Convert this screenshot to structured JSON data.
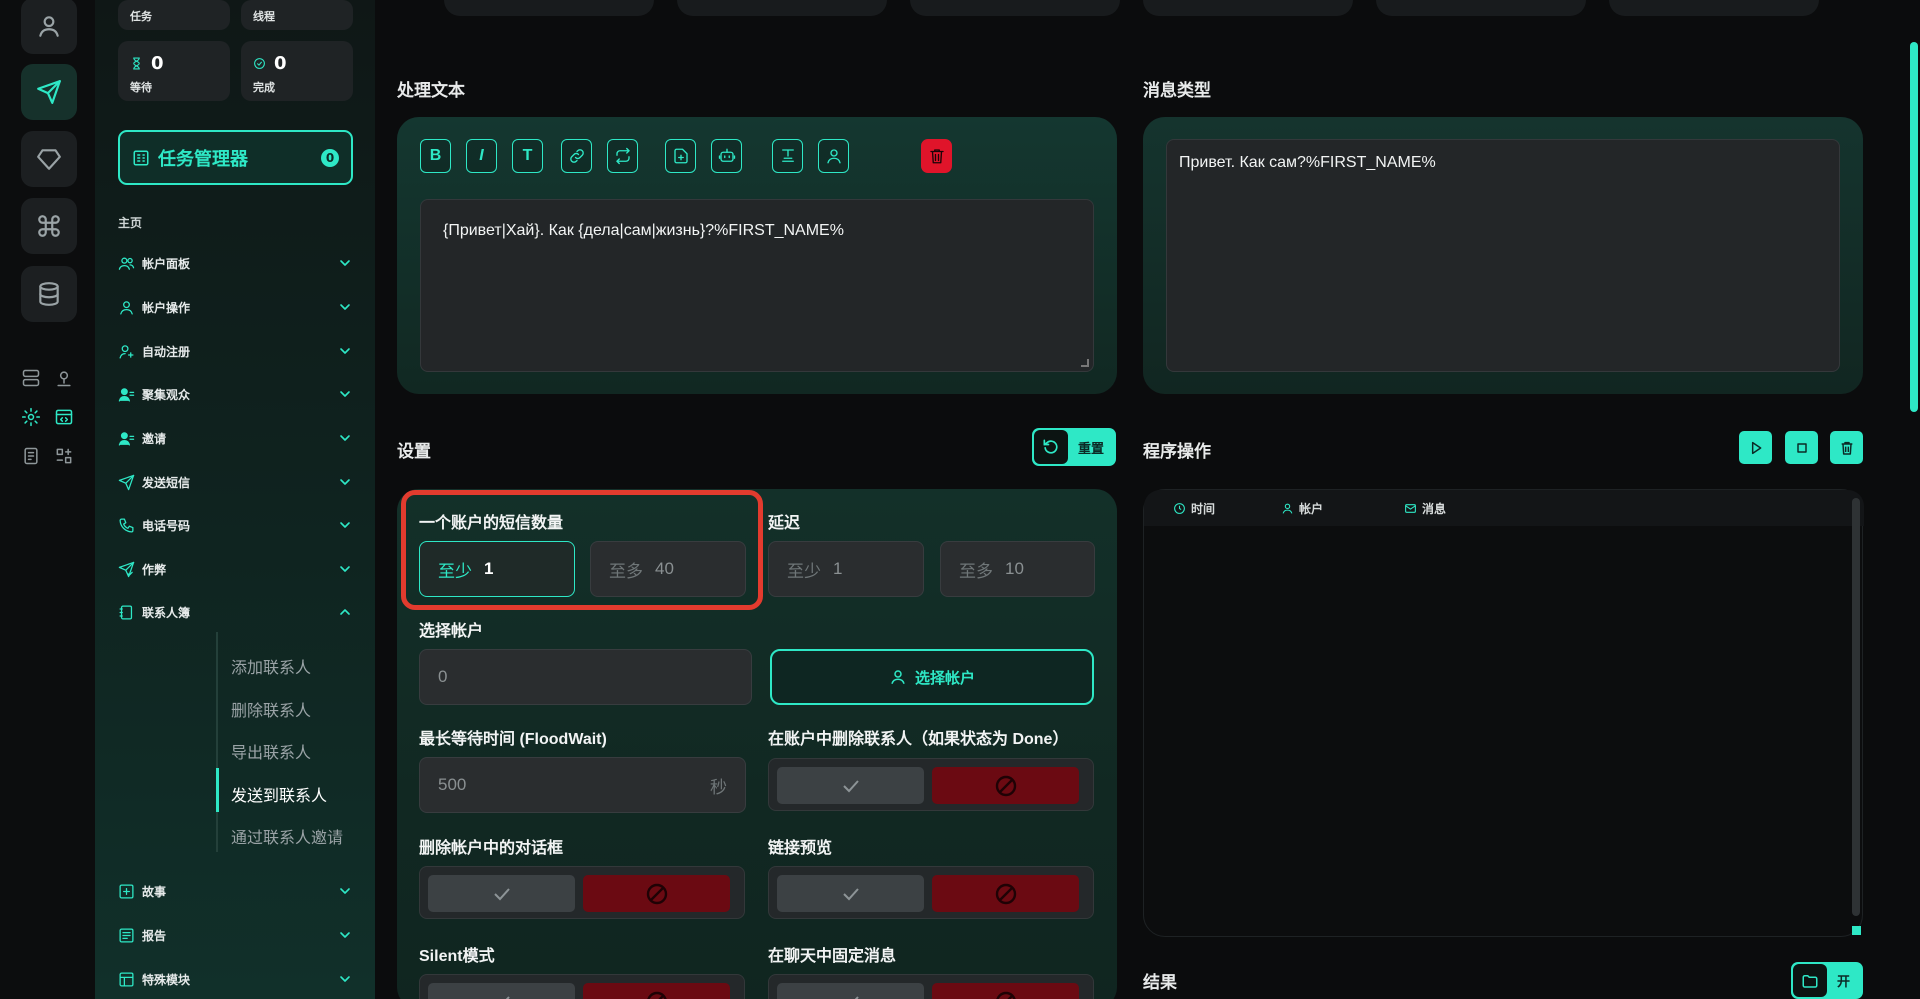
{
  "stats": {
    "tasks_label": "任务",
    "threads_label": "线程",
    "waiting_value": "0",
    "waiting_label": "等待",
    "done_value": "0",
    "done_label": "完成"
  },
  "task_manager": {
    "label": "任务管理器",
    "count": "0"
  },
  "sidebar": {
    "section": "主页",
    "items": [
      {
        "label": "帐户面板",
        "icon": "users-icon"
      },
      {
        "label": "帐户操作",
        "icon": "user-icon"
      },
      {
        "label": "自动注册",
        "icon": "user-plus-icon"
      },
      {
        "label": "聚集观众",
        "icon": "user-group-icon"
      },
      {
        "label": "邀请",
        "icon": "user-invite-icon"
      },
      {
        "label": "发送短信",
        "icon": "send-icon"
      },
      {
        "label": "电话号码",
        "icon": "phone-icon"
      },
      {
        "label": "作弊",
        "icon": "send-check-icon"
      },
      {
        "label": "联系人簿",
        "icon": "contacts-book-icon"
      }
    ],
    "sub_items": [
      "添加联系人",
      "删除联系人",
      "导出联系人",
      "发送到联系人",
      "通过联系人邀请"
    ],
    "bottom_items": [
      {
        "label": "故事",
        "icon": "plus-square-icon"
      },
      {
        "label": "报告",
        "icon": "report-icon"
      },
      {
        "label": "特殊模块",
        "icon": "module-icon"
      }
    ]
  },
  "editor": {
    "title": "处理文本",
    "text": "{Привет|Хай}. Как {дела|сам|жизнь}?%FIRST_NAME%",
    "toolbar": {
      "bold": "B",
      "italic": "I",
      "text": "T"
    }
  },
  "message_type": {
    "title": "消息类型",
    "preview": "Привет. Как сам?%FIRST_NAME%"
  },
  "settings": {
    "title": "设置",
    "reset_label": "重置",
    "sms_count_label": "一个账户的短信数量",
    "delay_label": "延迟",
    "min_label": "至少",
    "max_label": "至多",
    "sms_min": "1",
    "sms_max": "40",
    "delay_min": "1",
    "delay_max": "10",
    "select_accounts_label": "选择帐户",
    "accounts_value": "0",
    "select_accounts_button": "选择帐户",
    "floodwait_label": "最长等待时间 (FloodWait)",
    "floodwait_value": "500",
    "floodwait_unit": "秒",
    "delete_contacts_label": "在账户中删除联系人（如果状态为 Done）",
    "delete_dialogs_label": "删除帐户中的对话框",
    "link_preview_label": "链接预览",
    "silent_label": "Silent模式",
    "pin_label": "在聊天中固定消息"
  },
  "operations": {
    "title": "程序操作",
    "columns": [
      "时间",
      "帐户",
      "消息"
    ]
  },
  "results": {
    "title": "结果",
    "open_label": "开"
  },
  "colors": {
    "accent": "#2ee8c6",
    "danger": "#e0142a",
    "highlight": "#e23b2e"
  }
}
